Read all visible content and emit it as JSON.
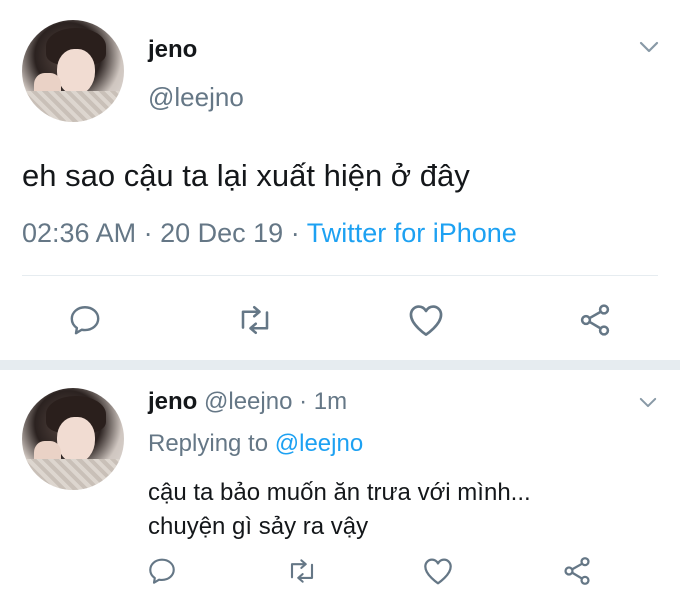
{
  "main_tweet": {
    "display_name": "jeno",
    "handle": "@leejno",
    "text": "eh sao cậu ta lại xuất hiện ở đây",
    "time": "02:36 AM",
    "sep1": "·",
    "date": "20 Dec 19",
    "sep2": "·",
    "source": "Twitter for iPhone"
  },
  "reply_tweet": {
    "display_name": "jeno",
    "handle": "@leejno",
    "sep": "·",
    "age": "1m",
    "replying_prefix": "Replying to",
    "replying_handle": "@leejno",
    "text_line1": "cậu ta bảo muốn ăn trưa với mình...",
    "text_line2": "chuyện gì sảy ra vậy"
  },
  "colors": {
    "text": "#14171a",
    "secondary": "#657786",
    "link": "#1da1f2",
    "divider": "#e6ecf0"
  },
  "icons": [
    "chevron-down-icon",
    "reply-icon",
    "retweet-icon",
    "like-icon",
    "share-icon"
  ]
}
